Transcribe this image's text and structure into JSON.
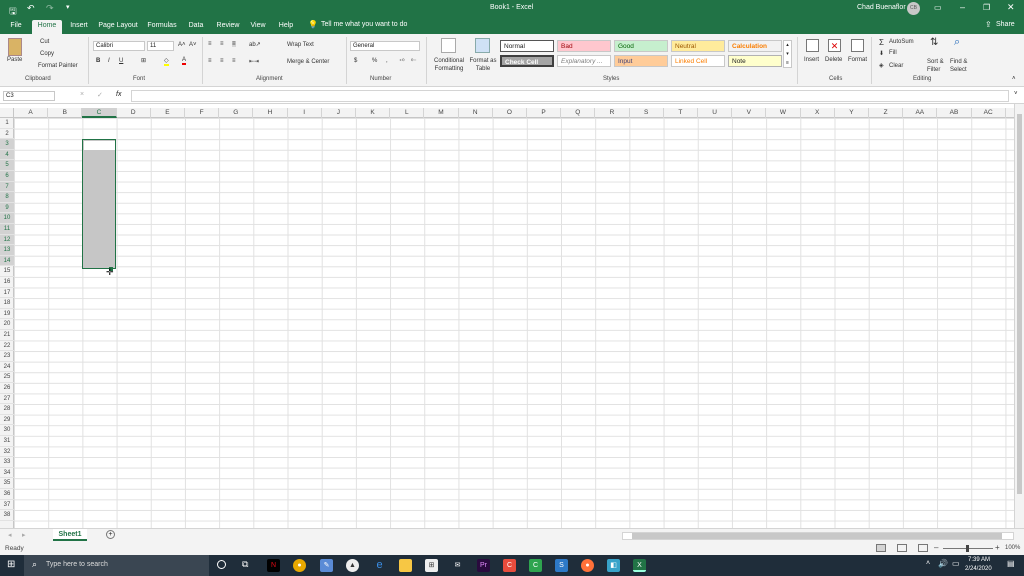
{
  "titlebar": {
    "title": "Book1 - Excel",
    "user": "Chad Buenaflor",
    "user_initials": "CB"
  },
  "tabs": [
    "File",
    "Home",
    "Insert",
    "Page Layout",
    "Formulas",
    "Data",
    "Review",
    "View",
    "Help"
  ],
  "tellme": "Tell me what you want to do",
  "share": "Share",
  "ribbon": {
    "clipboard": {
      "paste": "Paste",
      "cut": "Cut",
      "copy": "Copy",
      "format_painter": "Format Painter",
      "label": "Clipboard"
    },
    "font": {
      "name": "Calibri",
      "size": "11",
      "bold": "B",
      "italic": "I",
      "underline": "U",
      "label": "Font"
    },
    "alignment": {
      "wrap": "Wrap Text",
      "merge": "Merge & Center",
      "label": "Alignment"
    },
    "number": {
      "format": "General",
      "currency": "$",
      "percent": "%",
      "comma": ",",
      "label": "Number"
    },
    "styles": {
      "conditional": "Conditional Formatting",
      "format_table": "Format as Table",
      "normal": "Normal",
      "bad": "Bad",
      "good": "Good",
      "neutral": "Neutral",
      "calculation": "Calculation",
      "check_cell": "Check Cell",
      "explanatory": "Explanatory ...",
      "input": "Input",
      "linked_cell": "Linked Cell",
      "note": "Note",
      "label": "Styles"
    },
    "cells": {
      "insert": "Insert",
      "delete": "Delete",
      "format": "Format",
      "label": "Cells"
    },
    "editing": {
      "autosum": "AutoSum",
      "fill": "Fill",
      "clear": "Clear",
      "sort": "Sort & Filter",
      "find": "Find & Select",
      "label": "Editing"
    }
  },
  "formula_bar": {
    "name_box": "C3",
    "fx": "fx",
    "cancel": "×",
    "enter": "✓",
    "value": ""
  },
  "columns": [
    "A",
    "B",
    "C",
    "D",
    "E",
    "F",
    "G",
    "H",
    "I",
    "J",
    "K",
    "L",
    "M",
    "N",
    "O",
    "P",
    "Q",
    "R",
    "S",
    "T",
    "U",
    "V",
    "W",
    "X",
    "Y",
    "Z",
    "AA",
    "AB",
    "AC"
  ],
  "rows": [
    "1",
    "2",
    "3",
    "4",
    "5",
    "6",
    "7",
    "8",
    "9",
    "10",
    "11",
    "12",
    "13",
    "14",
    "15",
    "16",
    "17",
    "18",
    "19",
    "20",
    "21",
    "22",
    "23",
    "24",
    "25",
    "26",
    "27",
    "28",
    "29",
    "30",
    "31",
    "32",
    "33",
    "34",
    "35",
    "36",
    "37",
    "38"
  ],
  "selected_column": "C",
  "selected_rows": [
    "3",
    "4",
    "5",
    "6",
    "7",
    "8",
    "9",
    "10",
    "11",
    "12",
    "13",
    "14"
  ],
  "sheet": {
    "name": "Sheet1",
    "add": "+"
  },
  "status": {
    "ready": "Ready",
    "zoom": "100%"
  },
  "taskbar": {
    "search_placeholder": "Type here to search",
    "time": "7:39 AM",
    "date": "2/24/2020"
  },
  "colors": {
    "accent": "#217346",
    "taskbar": "#1f2d3a"
  }
}
